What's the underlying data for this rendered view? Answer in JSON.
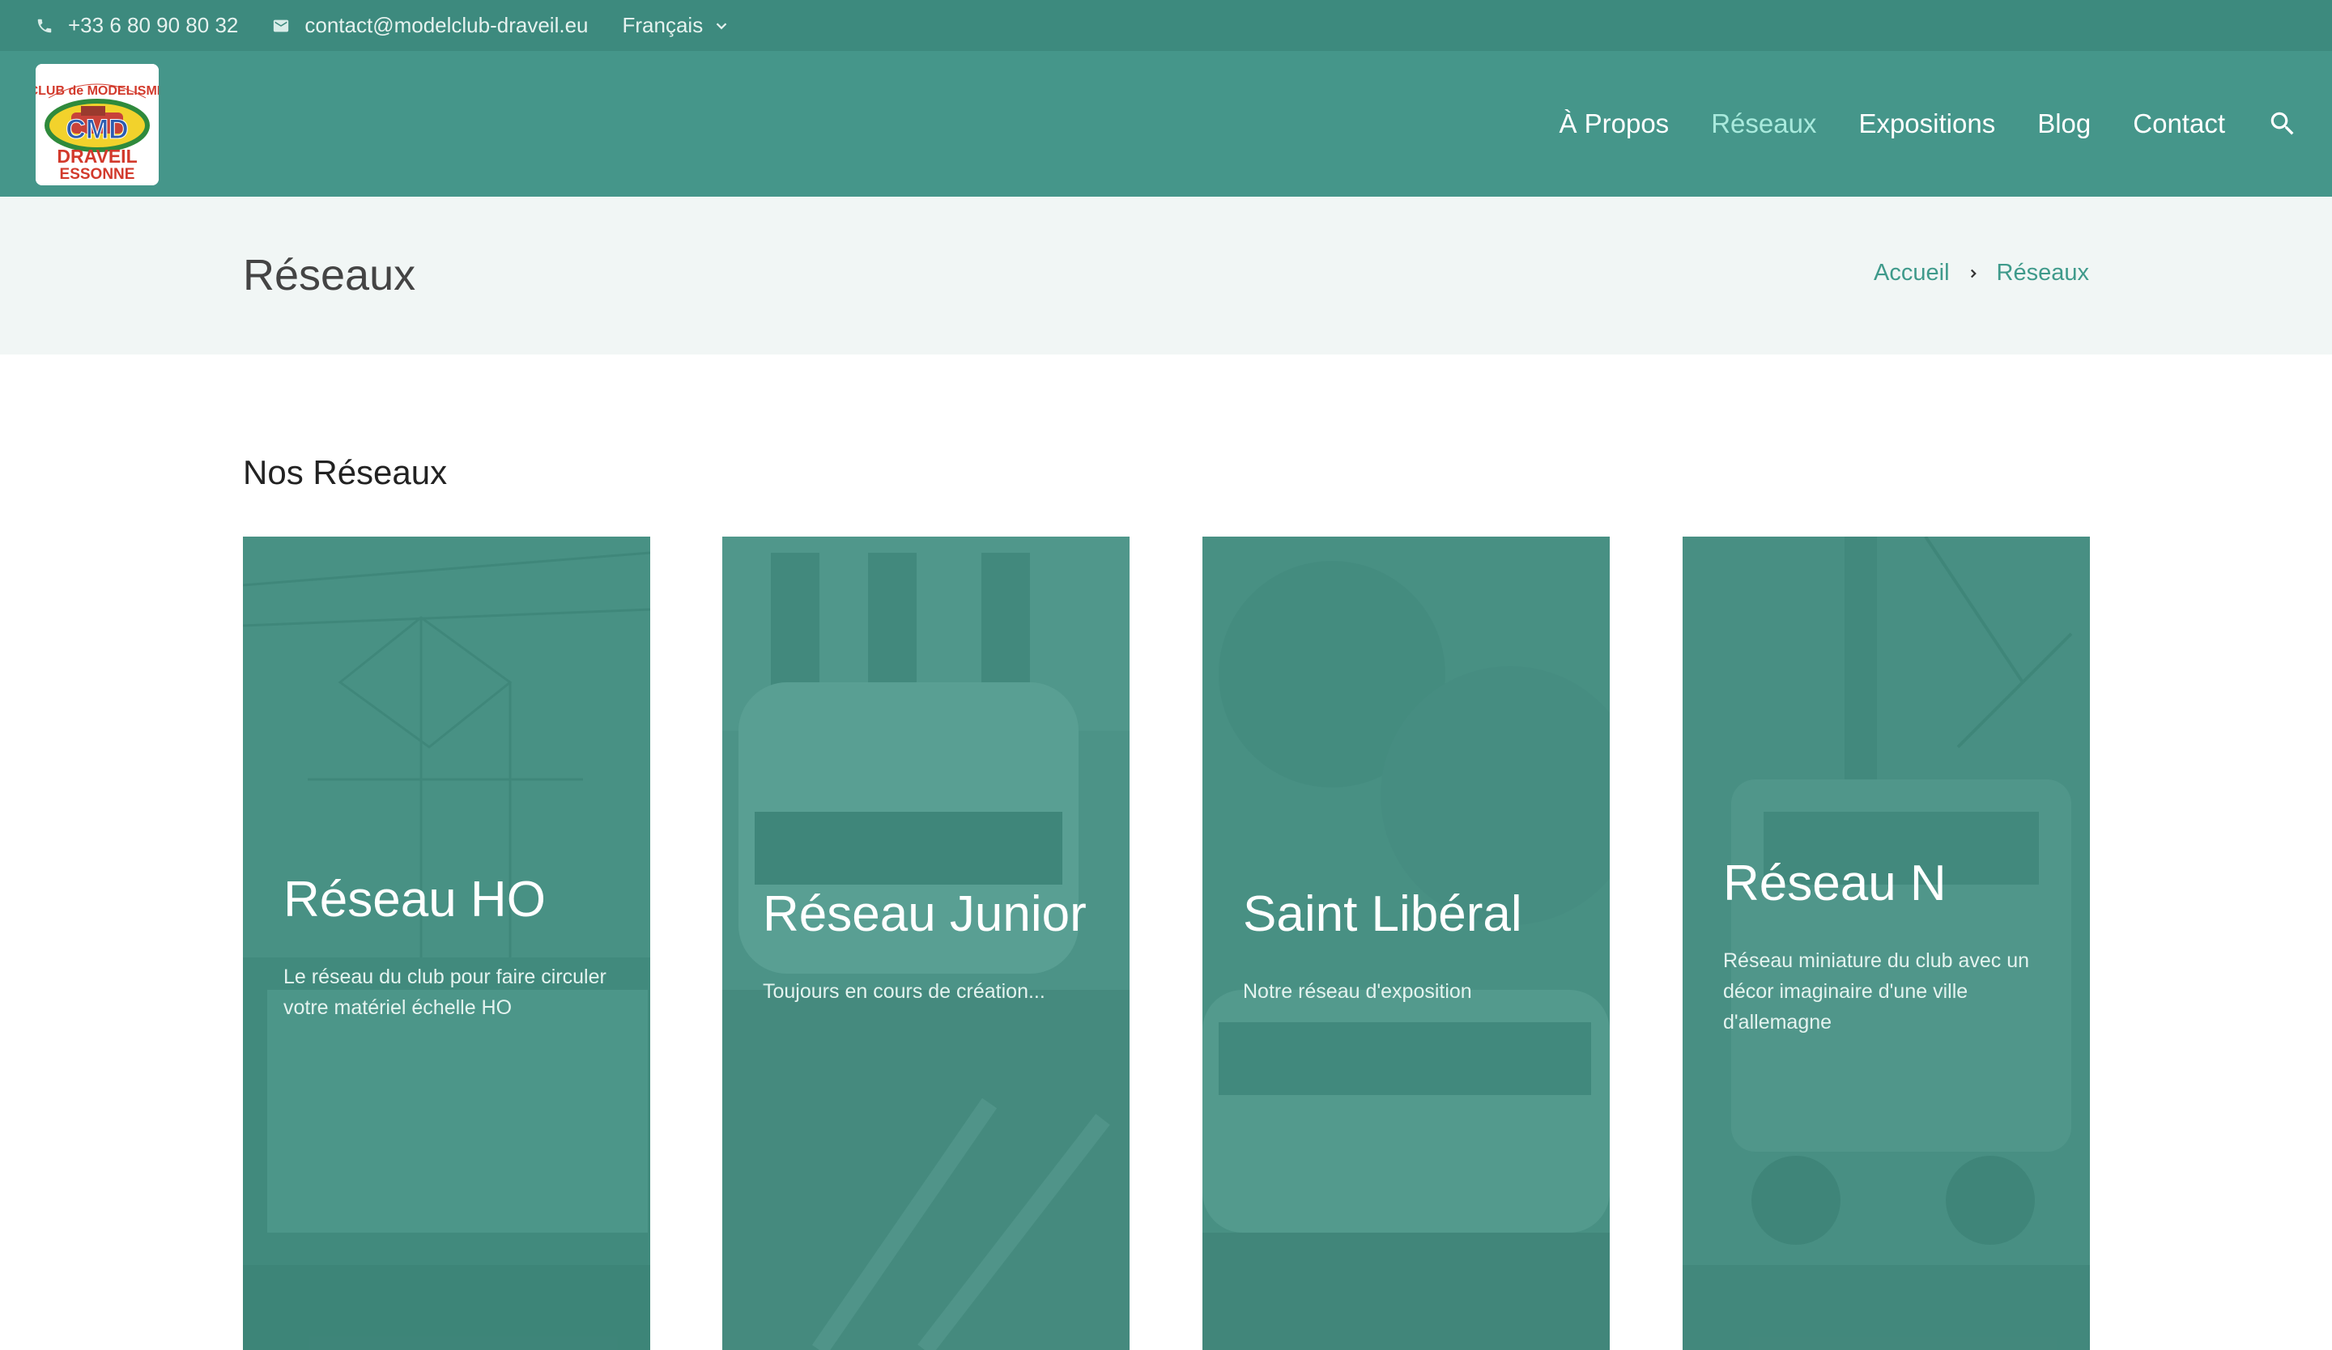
{
  "topbar": {
    "phone": "+33 6 80 90 80 32",
    "email": "contact@modelclub-draveil.eu",
    "language": "Français"
  },
  "logo": {
    "line1": "CLUB de MODELISME",
    "mark": "CMD",
    "line2": "DRAVEIL",
    "line3": "ESSONNE"
  },
  "nav": {
    "items": [
      {
        "label": "À Propos"
      },
      {
        "label": "Réseaux"
      },
      {
        "label": "Expositions"
      },
      {
        "label": "Blog"
      },
      {
        "label": "Contact"
      }
    ]
  },
  "page": {
    "title": "Réseaux",
    "breadcrumb": {
      "home": "Accueil",
      "current": "Réseaux"
    }
  },
  "section": {
    "title": "Nos Réseaux",
    "cards": [
      {
        "title": "Réseau HO",
        "text": "Le réseau du club pour faire circuler votre matériel échelle HO"
      },
      {
        "title": "Réseau Junior",
        "text": "Toujours en cours de création..."
      },
      {
        "title": "Saint Libéral",
        "text": "Notre réseau d'exposition"
      },
      {
        "title": "Réseau N",
        "text": "Réseau miniature du club avec un décor imaginaire d'une ville d'allemagne"
      }
    ]
  },
  "colors": {
    "topbar": "#3d8a7e",
    "header": "#45968a",
    "accent": "#3f9a8b",
    "active_nav": "#a9eadd",
    "card_tint": "#3f9284"
  },
  "icons": {
    "phone": "phone-icon",
    "email": "email-icon",
    "language_toggle": "chevron-down-icon",
    "search": "search-icon",
    "breadcrumb_separator": "chevron-right-icon"
  }
}
